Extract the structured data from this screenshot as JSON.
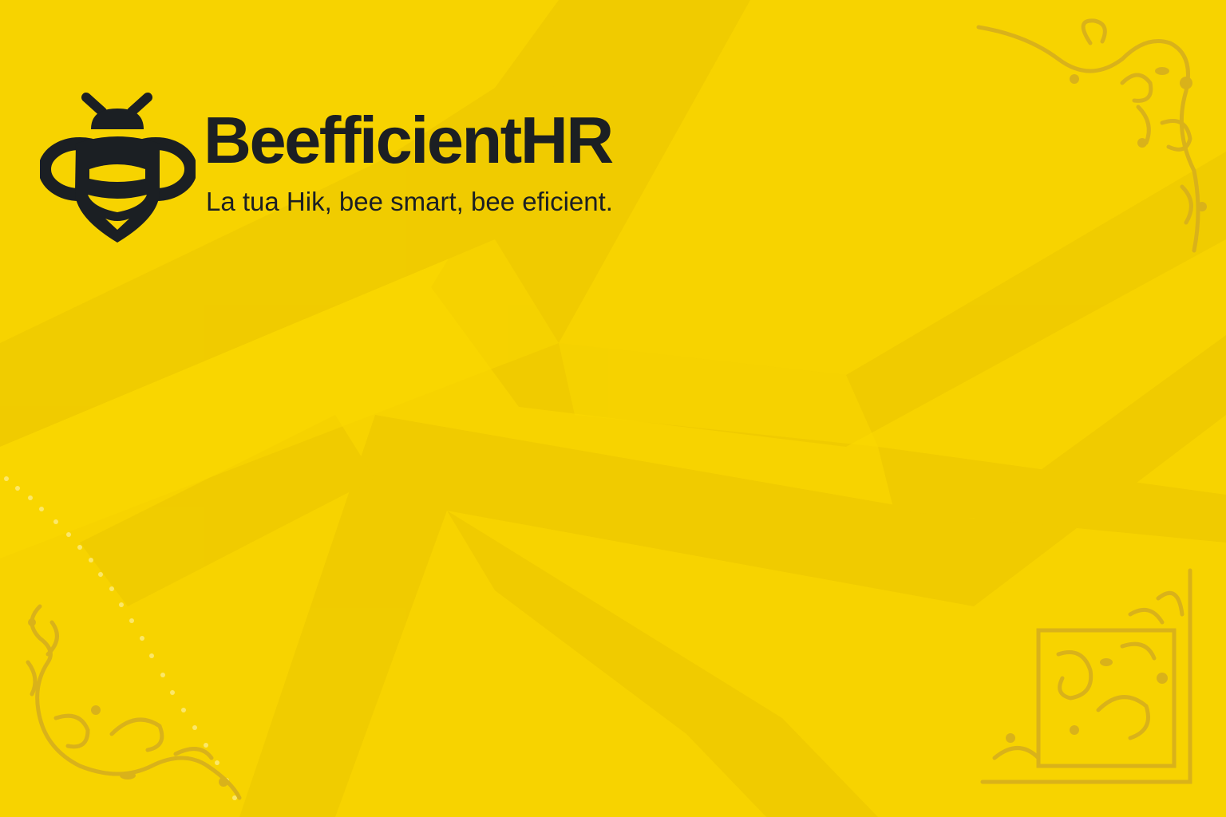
{
  "brand": {
    "name": "BeefficientHR",
    "tagline": "La tua Hik, bee smart, bee eficient."
  },
  "icons": {
    "logo": "bee-icon",
    "corner_top_right": "floral-ornament-icon",
    "corner_bottom_left": "floral-ornament-icon",
    "corner_bottom_right": "floral-ornament-icon"
  },
  "colors": {
    "background": "#f7d300",
    "background_pattern": "#eec900",
    "text": "#1b1f23",
    "ornament": "#d9b21a"
  }
}
